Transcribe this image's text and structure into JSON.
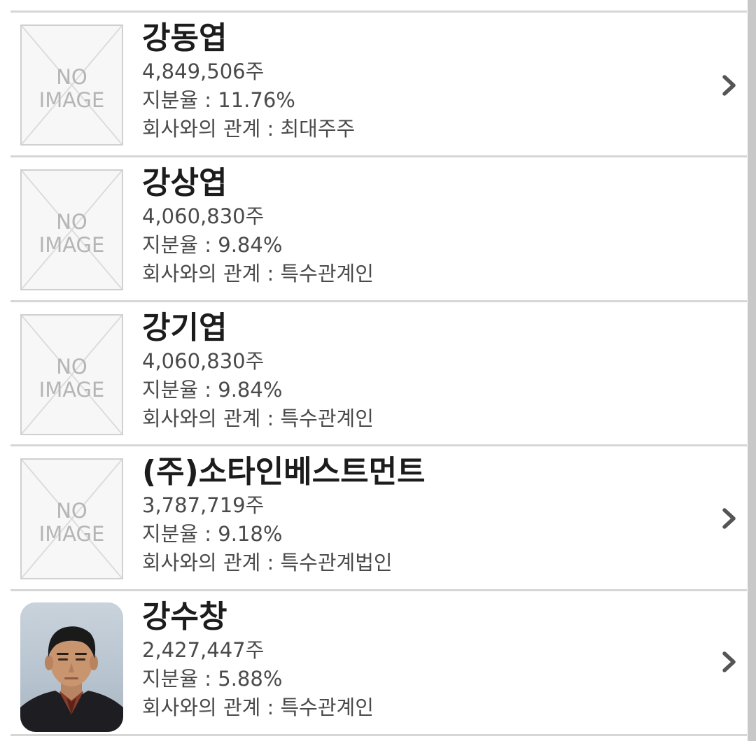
{
  "colors": {
    "name_text": "#1c1c1c",
    "detail_text": "#4a4a4a",
    "divider": "#d6d6d6",
    "chevron": "#555555",
    "scrollbar": "#c8c8c8"
  },
  "shareholders": [
    {
      "name": "강동엽",
      "shares": "4,849,506주",
      "ratio": "지분율 : 11.76%",
      "relation": "회사와의 관계 : 최대주주",
      "image": "no-image-placeholder",
      "image_text_1": "NO",
      "image_text_2": "IMAGE",
      "has_chevron": true
    },
    {
      "name": "강상엽",
      "shares": "4,060,830주",
      "ratio": "지분율 : 9.84%",
      "relation": "회사와의 관계 : 특수관계인",
      "image": "no-image-placeholder",
      "image_text_1": "NO",
      "image_text_2": "IMAGE",
      "has_chevron": false
    },
    {
      "name": "강기엽",
      "shares": "4,060,830주",
      "ratio": "지분율 : 9.84%",
      "relation": "회사와의 관계 : 특수관계인",
      "image": "no-image-placeholder",
      "image_text_1": "NO",
      "image_text_2": "IMAGE",
      "has_chevron": false
    },
    {
      "name": "(주)소타인베스트먼트",
      "shares": "3,787,719주",
      "ratio": "지분율 : 9.18%",
      "relation": "회사와의 관계 : 특수관계법인",
      "image": "no-image-placeholder",
      "image_text_1": "NO",
      "image_text_2": "IMAGE",
      "has_chevron": true
    },
    {
      "name": "강수창",
      "shares": "2,427,447주",
      "ratio": "지분율 : 5.88%",
      "relation": "회사와의 관계 : 특수관계인",
      "image": "portrait-photo",
      "has_chevron": true
    }
  ]
}
